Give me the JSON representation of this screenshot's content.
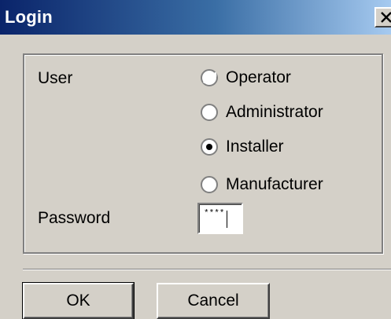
{
  "window": {
    "title": "Login"
  },
  "form": {
    "user_label": "User",
    "password_label": "Password",
    "user_options": [
      {
        "label": "Operator",
        "selected": false
      },
      {
        "label": "Administrator",
        "selected": false
      },
      {
        "label": "Installer",
        "selected": true
      },
      {
        "label": "Manufacturer",
        "selected": false
      }
    ],
    "password_value": "****"
  },
  "buttons": {
    "ok_label": "OK",
    "cancel_label": "Cancel"
  },
  "colors": {
    "titlebar_start": "#0a246a",
    "titlebar_end": "#a6caf0",
    "face": "#d4d0c8"
  },
  "icons": {
    "close": "close-icon",
    "radio": "radio-icon"
  }
}
